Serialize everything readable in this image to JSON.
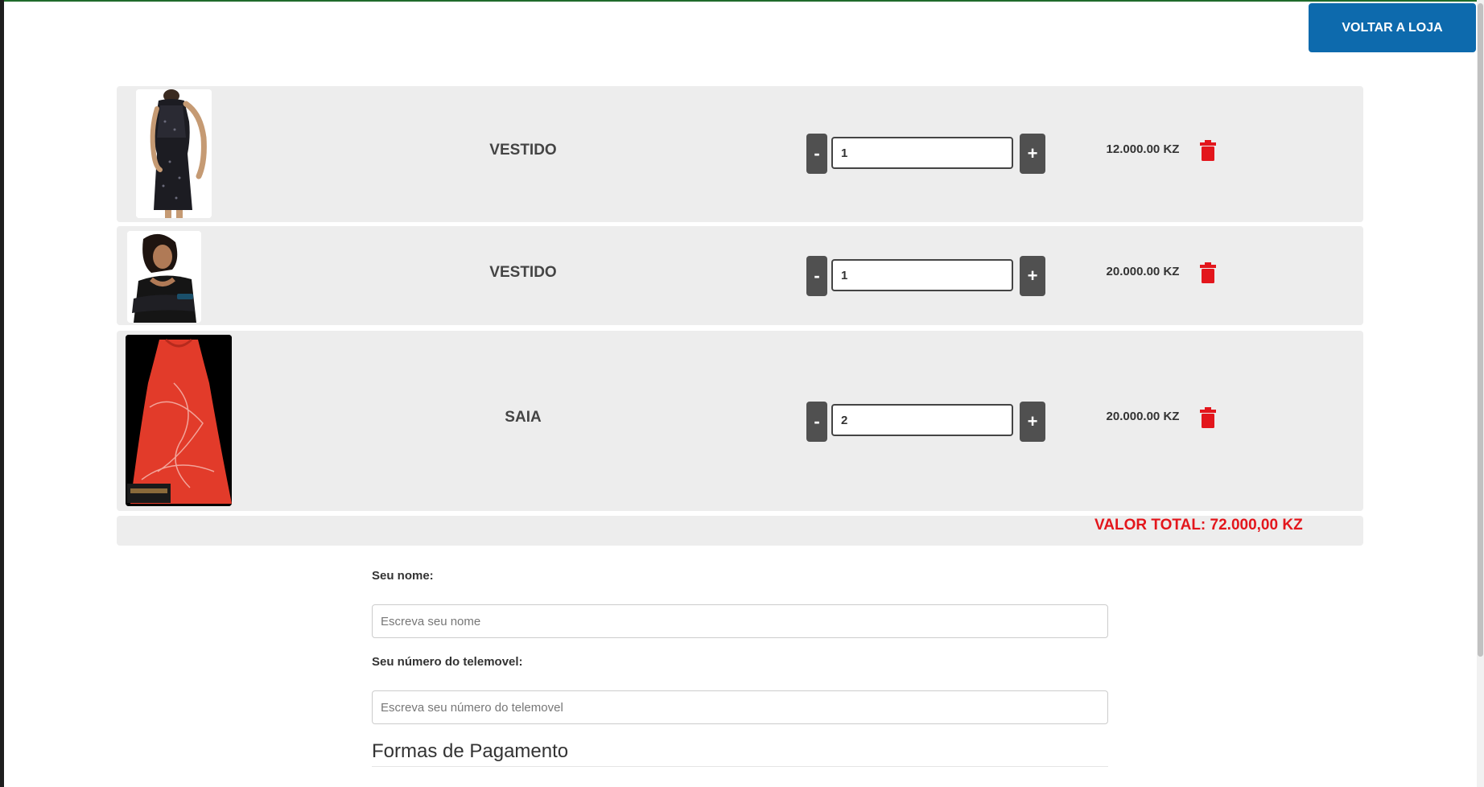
{
  "header": {
    "back_button_label": "VOLTAR A LOJA"
  },
  "cart": {
    "items": [
      {
        "name": "VESTIDO",
        "quantity": "1",
        "price": "12.000.00 KZ",
        "image": "black-sequin-dress-photo"
      },
      {
        "name": "VESTIDO",
        "quantity": "1",
        "price": "20.000.00 KZ",
        "image": "woman-black-dress-photo"
      },
      {
        "name": "SAIA",
        "quantity": "2",
        "price": "20.000.00 KZ",
        "image": "red-dress-photo"
      }
    ],
    "minus_label": "-",
    "plus_label": "+",
    "total_label": "VALOR TOTAL: 72.000,00 KZ"
  },
  "form": {
    "name_label": "Seu nome:",
    "name_placeholder": "Escreva seu nome",
    "phone_label": "Seu número do telemovel:",
    "phone_placeholder": "Escreva seu número do telemovel",
    "payment_title": "Formas de Pagamento"
  },
  "colors": {
    "accent_button": "#0d6aad",
    "total_text": "#e3161c",
    "trash_icon": "#e3161c",
    "row_background": "#ededed"
  }
}
